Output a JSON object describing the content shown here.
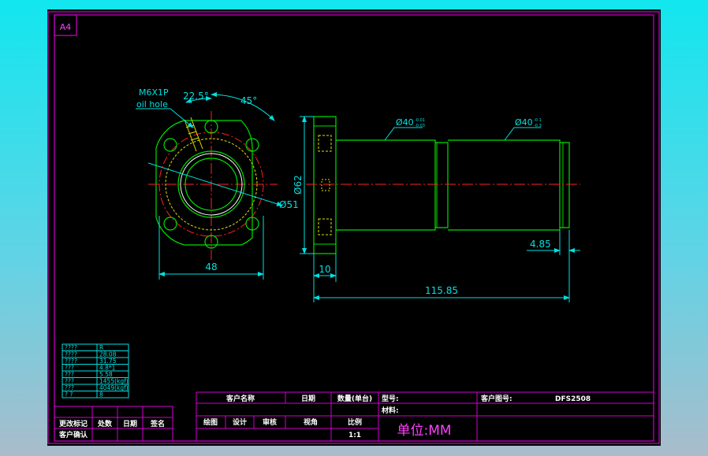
{
  "sheet": {
    "size_tag": "A4"
  },
  "colors": {
    "frame": "#d000d0",
    "outline": "#00e000",
    "dimension": "#00e0e0",
    "center": "#ff2020",
    "hidden": "#e0e000",
    "part": "#ffffff",
    "label": "#ff40ff"
  },
  "front_view": {
    "thread_label": "M6X1P",
    "hole_label": "oil hole",
    "angle_small": "22.5°",
    "angle_large": "45°",
    "pcd_label": "Ø51",
    "width_label": "48"
  },
  "side_view": {
    "flange_dia": "Ø62",
    "shaft_dia_1": "Ø40",
    "shaft_tol_1_upper": "-0.01",
    "shaft_tol_1_lower": "-0.03",
    "shaft_dia_2": "Ø40",
    "shaft_tol_2_upper": "-0.1",
    "shaft_tol_2_lower": "-0.3",
    "end_length": "4.85",
    "flange_thickness": "10",
    "total_length": "115.85"
  },
  "spec_table": {
    "rows": [
      [
        "????",
        "R"
      ],
      [
        "????",
        "28.08"
      ],
      [
        "????",
        "31.75"
      ],
      [
        "???",
        "4.8*1"
      ],
      [
        "???",
        "5.58"
      ],
      [
        "???",
        "1455(kgf)"
      ],
      [
        "???",
        "4049(kgf)"
      ],
      [
        "? ?",
        "8"
      ]
    ]
  },
  "revision_block": {
    "row1": [
      "更改标记",
      "处数",
      "日期",
      "签名"
    ],
    "row2": "客户确认"
  },
  "title_block": {
    "customer_name": "客户名称",
    "date": "日期",
    "qty": "数量(单台)",
    "model_label": "型号:",
    "drawing_no_label": "客户图号:",
    "drawing_no": "DFS2508",
    "material_label": "材料:",
    "drafter": "绘图",
    "designer": "设计",
    "checker": "审核",
    "view_angle": "视角",
    "scale_label": "比例",
    "scale": "1:1",
    "unit": "单位:MM"
  }
}
